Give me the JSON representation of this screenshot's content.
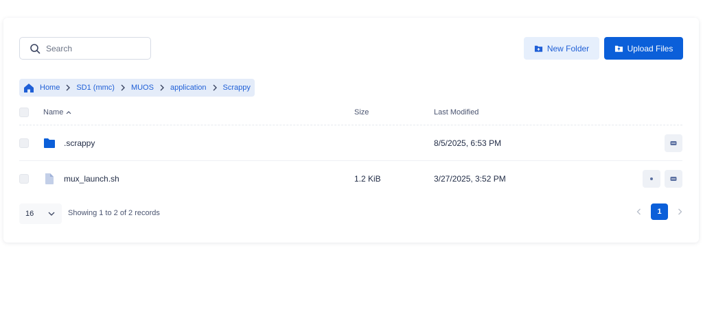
{
  "search": {
    "placeholder": "Search",
    "value": ""
  },
  "toolbar": {
    "new_folder_label": "New Folder",
    "upload_label": "Upload Files"
  },
  "breadcrumb": [
    "Home",
    "SD1 (mmc)",
    "MUOS",
    "application",
    "Scrappy"
  ],
  "table": {
    "columns": {
      "name": "Name",
      "size": "Size",
      "modified": "Last Modified"
    },
    "rows": [
      {
        "name": ".scrappy",
        "type": "folder",
        "size": "",
        "modified": "8/5/2025, 6:53 PM"
      },
      {
        "name": "mux_launch.sh",
        "type": "file",
        "size": "1.2 KiB",
        "modified": "3/27/2025, 3:52 PM"
      }
    ]
  },
  "footer": {
    "per_page": "16",
    "records_text": "Showing 1 to 2 of 2 records",
    "current_page": "1"
  },
  "colors": {
    "accent": "#0b5fd9",
    "accent_light": "#e6effc",
    "folder": "#0b5fd9",
    "file": "#b9c7e6"
  },
  "icons": [
    "search-icon",
    "folder-plus-icon",
    "upload-icon",
    "home-icon",
    "chevron-right-icon",
    "sort-up-icon",
    "folder-icon",
    "file-icon",
    "eye-icon",
    "more-icon",
    "chevron-down-icon",
    "chevron-left-icon"
  ]
}
